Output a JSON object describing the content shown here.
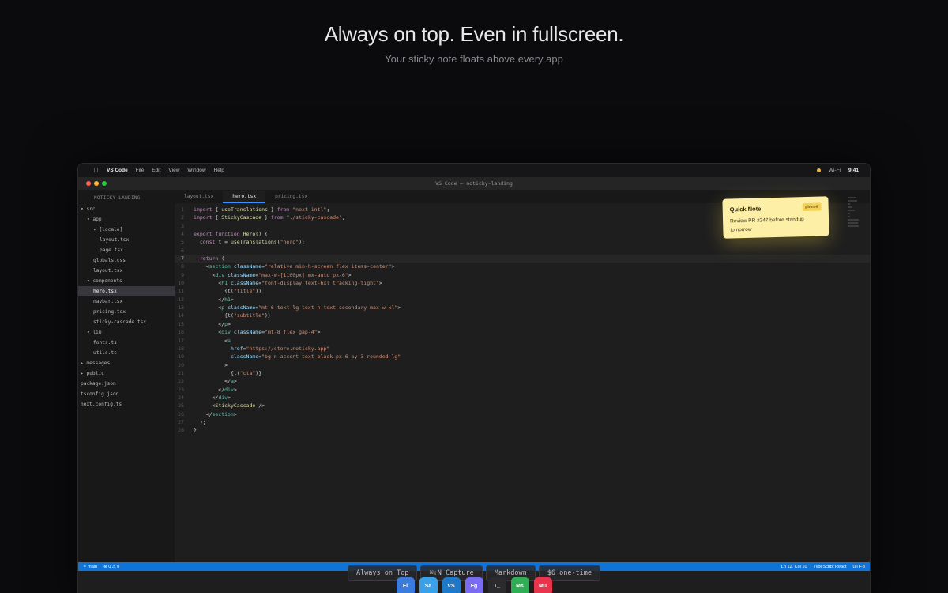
{
  "hero": {
    "title": "Always on top. Even in fullscreen.",
    "subtitle": "Your sticky note floats above every app"
  },
  "menubar": {
    "app": "VS Code",
    "items": [
      "File",
      "Edit",
      "View",
      "Window",
      "Help"
    ],
    "wifi": "Wi-Fi",
    "clock": "9:41"
  },
  "window": {
    "title": "VS Code — noticky-landing"
  },
  "explorer": {
    "title": "NOTICKY-LANDING",
    "items": [
      {
        "label": "▾ src",
        "indent": 0
      },
      {
        "label": "▾ app",
        "indent": 1
      },
      {
        "label": "▾ [locale]",
        "indent": 2
      },
      {
        "label": "layout.tsx",
        "indent": 3
      },
      {
        "label": "page.tsx",
        "indent": 3
      },
      {
        "label": "globals.css",
        "indent": 2
      },
      {
        "label": "layout.tsx",
        "indent": 2
      },
      {
        "label": "▾ components",
        "indent": 1
      },
      {
        "label": "hero.tsx",
        "indent": 2,
        "active": true
      },
      {
        "label": "navbar.tsx",
        "indent": 2
      },
      {
        "label": "pricing.tsx",
        "indent": 2
      },
      {
        "label": "sticky-cascade.tsx",
        "indent": 2
      },
      {
        "label": "▾ lib",
        "indent": 1
      },
      {
        "label": "fonts.ts",
        "indent": 2
      },
      {
        "label": "utils.ts",
        "indent": 2
      },
      {
        "label": "▸ messages",
        "indent": 0
      },
      {
        "label": "▸ public",
        "indent": 0
      },
      {
        "label": "package.json",
        "indent": 0
      },
      {
        "label": "tsconfig.json",
        "indent": 0
      },
      {
        "label": "next.config.ts",
        "indent": 0
      }
    ]
  },
  "tabs": [
    {
      "label": "layout.tsx",
      "active": false
    },
    {
      "label": "hero.tsx",
      "active": true
    },
    {
      "label": "pricing.tsx",
      "active": false
    }
  ],
  "code": {
    "current_line": 7,
    "lines": [
      "import { useTranslations } from \"next-intl\";",
      "import { StickyCascade } from \"./sticky-cascade\";",
      "",
      "export function Hero() {",
      "  const t = useTranslations(\"hero\");",
      "",
      "  return (",
      "    <section className=\"relative min-h-screen flex items-center\">",
      "      <div className=\"max-w-[1100px] mx-auto px-6\">",
      "        <h1 className=\"font-display text-6xl tracking-tight\">",
      "          {t(\"title\")}",
      "        </h1>",
      "        <p className=\"mt-6 text-lg text-n-text-secondary max-w-xl\">",
      "          {t(\"subtitle\")}",
      "        </p>",
      "        <div className=\"mt-8 flex gap-4\">",
      "          <a",
      "            href=\"https://store.noticky.app\"",
      "            className=\"bg-n-accent text-black px-6 py-3 rounded-lg\"",
      "          >",
      "            {t(\"cta\")}",
      "          </a>",
      "        </div>",
      "      </div>",
      "      <StickyCascade />",
      "    </section>",
      "  );",
      "}"
    ]
  },
  "sticky_note": {
    "title": "Quick Note",
    "badge": "pinned",
    "body": "Review PR #247 before standup tomorrow"
  },
  "statusbar": {
    "branch": "✦ main",
    "problems": "⊗ 0 ⚠ 0",
    "position": "Ln 12, Col 10",
    "language": "TypeScript React",
    "encoding": "UTF-8"
  },
  "features": [
    "Always on Top",
    "⌘⇧N Capture",
    "Markdown",
    "$6 one-time"
  ],
  "dock": [
    {
      "label": "Fi",
      "color": "#3b7bdc"
    },
    {
      "label": "Sa",
      "color": "#3aa0e8"
    },
    {
      "label": "VS",
      "color": "#1f78c8"
    },
    {
      "label": "Fg",
      "color": "#7a6cf0"
    },
    {
      "label": "T_",
      "color": "#2b2b2e"
    },
    {
      "label": "Ms",
      "color": "#2fae55"
    },
    {
      "label": "Mu",
      "color": "#e8344d"
    }
  ]
}
